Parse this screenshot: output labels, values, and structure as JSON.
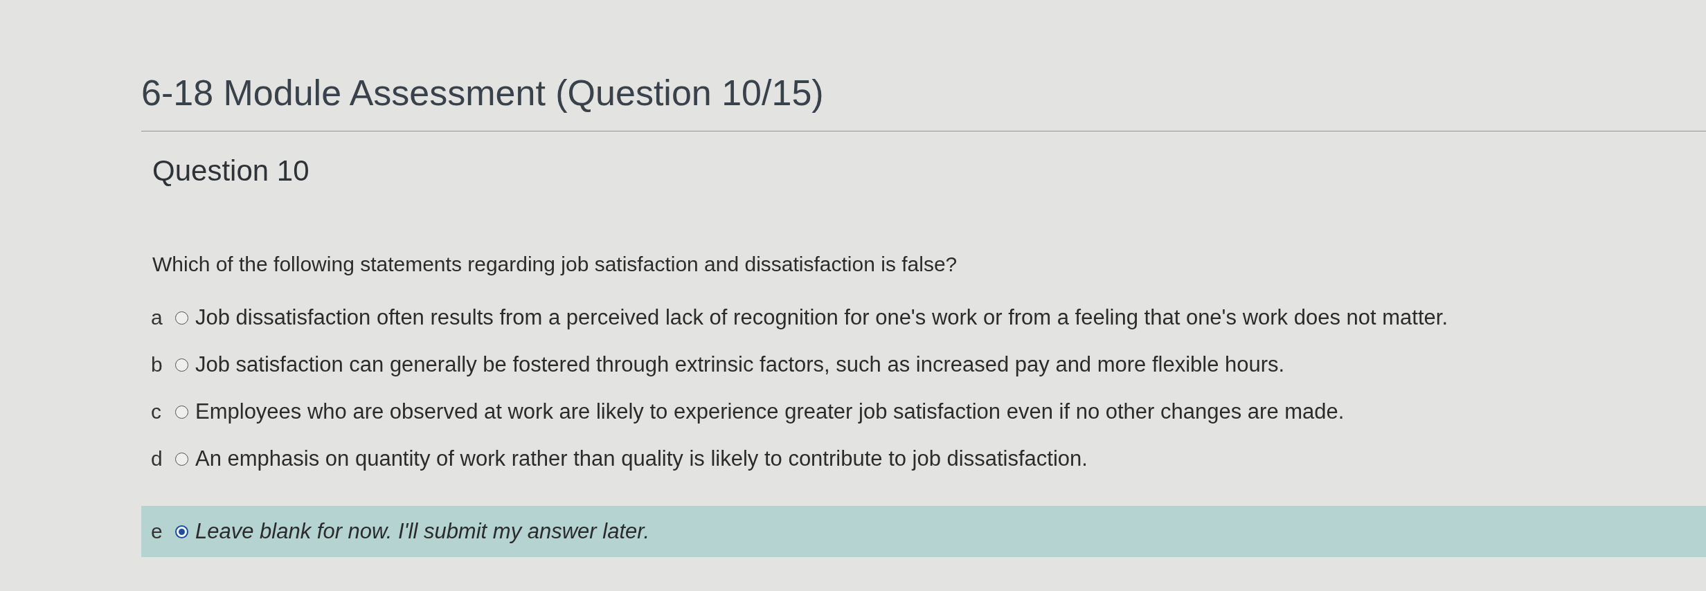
{
  "header": {
    "title": "6-18 Module Assessment (Question 10/15)"
  },
  "question": {
    "heading": "Question 10",
    "prompt": "Which of the following statements regarding job satisfaction and dissatisfaction is false?",
    "options": [
      {
        "kind": "answer",
        "letter": "a",
        "text": "Job dissatisfaction often results from a perceived lack of recognition for one's work or from a feeling that one's work does not matter.",
        "selected": false
      },
      {
        "kind": "answer",
        "letter": "b",
        "text": "Job satisfaction can generally be fostered through extrinsic factors, such as increased pay and more flexible hours.",
        "selected": false
      },
      {
        "kind": "answer",
        "letter": "c",
        "text": "Employees who are observed at work are likely to experience greater job satisfaction even if no other changes are made.",
        "selected": false
      },
      {
        "kind": "answer",
        "letter": "d",
        "text": "An emphasis on quantity of work rather than quality is likely to contribute to job dissatisfaction.",
        "selected": false
      },
      {
        "kind": "skip",
        "letter": "e",
        "text": "Leave blank for now. I'll submit my answer later.",
        "selected": true
      }
    ]
  }
}
